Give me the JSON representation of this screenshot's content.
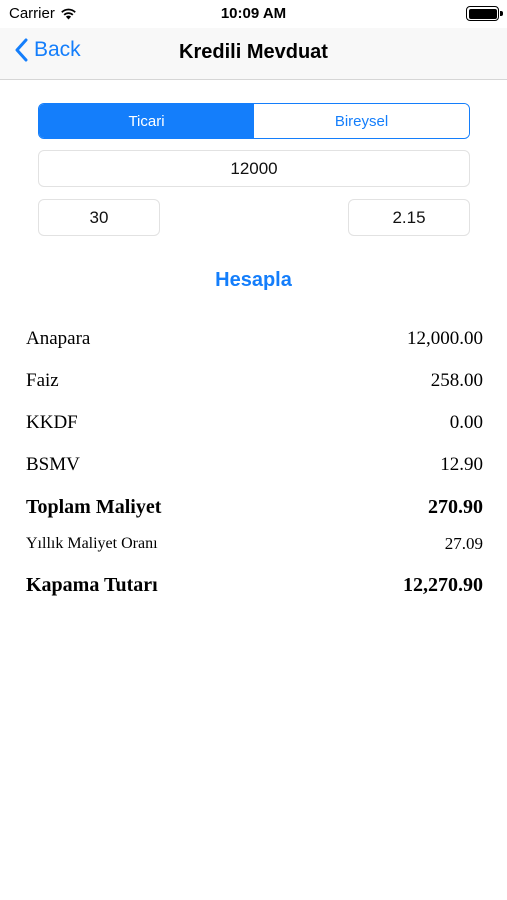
{
  "status_bar": {
    "carrier": "Carrier",
    "time": "10:09 AM"
  },
  "nav": {
    "back_label": "Back",
    "title": "Kredili Mevduat"
  },
  "segments": {
    "left": "Ticari",
    "right": "Bireysel",
    "selected": "Ticari"
  },
  "inputs": {
    "amount": "12000",
    "days": "30",
    "rate": "2.15"
  },
  "calculate_label": "Hesapla",
  "results": [
    {
      "label": "Anapara",
      "value": "12,000.00"
    },
    {
      "label": "Faiz",
      "value": "258.00"
    },
    {
      "label": "KKDF",
      "value": "0.00"
    },
    {
      "label": "BSMV",
      "value": "12.90"
    },
    {
      "label": "Toplam Maliyet",
      "value": "270.90"
    },
    {
      "label": "Yıllık Maliyet Oranı",
      "value": "27.09"
    },
    {
      "label": "Kapama Tutarı",
      "value": "12,270.90"
    }
  ],
  "colors": {
    "accent": "#147efb",
    "field_border": "#e2e2e2"
  }
}
